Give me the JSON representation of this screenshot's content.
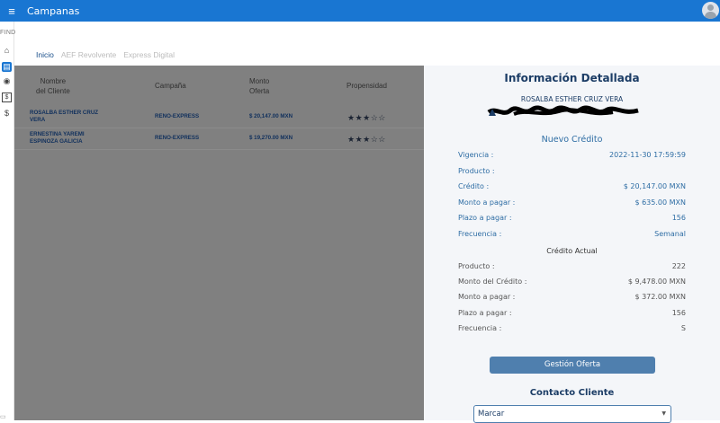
{
  "header": {
    "title": "Campanas",
    "menu_icon": "menu-icon",
    "avatar_icon": "account-icon"
  },
  "sidebar": {
    "find_label": "FIND",
    "items": [
      {
        "icon": "home-icon",
        "glyph": "⌂"
      },
      {
        "icon": "card-icon",
        "glyph": "▤"
      },
      {
        "icon": "target-icon",
        "glyph": "◉"
      },
      {
        "icon": "cash-icon",
        "glyph": "$"
      },
      {
        "icon": "dollar-icon",
        "glyph": "$"
      }
    ]
  },
  "tabs": [
    {
      "label": "Inicio",
      "active": true
    },
    {
      "label": "AEF Revolvente",
      "active": false
    },
    {
      "label": "Express Digital",
      "active": false
    }
  ],
  "table": {
    "headers": {
      "client": "Nombre\ndel Cliente",
      "campaign": "Campaña",
      "amount": "Monto\nOferta",
      "propensity": "Propensidad"
    },
    "rows": [
      {
        "client": "ROSALBA ESTHER CRUZ VERA",
        "campaign": "RENO-EXPRESS",
        "amount": "$ 20,147.00 MXN",
        "stars": "★★★☆☆"
      },
      {
        "client": "ERNESTINA YAREMI ESPINOZA GALICIA",
        "campaign": "RENO-EXPRESS",
        "amount": "$ 19,270.00 MXN",
        "stars": "★★★☆☆"
      }
    ]
  },
  "detail": {
    "title": "Información Detallada",
    "client_name": "ROSALBA ESTHER  CRUZ VERA",
    "new_credit": {
      "heading": "Nuevo Crédito",
      "fields": [
        {
          "label": "Vigencia :",
          "value": "2022-11-30 17:59:59"
        },
        {
          "label": "Producto  :",
          "value": ""
        },
        {
          "label": "Crédito :",
          "value": "$ 20,147.00 MXN"
        },
        {
          "label": "Monto a pagar :",
          "value": "$ 635.00 MXN"
        },
        {
          "label": "Plazo a pagar :",
          "value": "156"
        },
        {
          "label": "Frecuencia :",
          "value": "Semanal"
        }
      ]
    },
    "current_credit": {
      "heading": "Crédito Actual",
      "fields": [
        {
          "label": "Producto :",
          "value": "222"
        },
        {
          "label": "Monto del Crédito :",
          "value": "$ 9,478.00 MXN"
        },
        {
          "label": "Monto a pagar :",
          "value": "$ 372.00 MXN"
        },
        {
          "label": "Plazo a pagar :",
          "value": "156"
        },
        {
          "label": "Frecuencia :",
          "value": "S"
        }
      ]
    },
    "button_label": "Gestión Oferta",
    "contact_heading": "Contacto Cliente",
    "contact_select": "Marcar"
  },
  "colors": {
    "primary": "#1976d2",
    "overlay": "#808080",
    "accent": "#2e6da4",
    "button": "#4f7fae"
  }
}
